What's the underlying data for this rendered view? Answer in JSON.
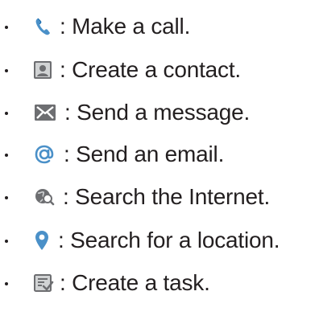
{
  "items": [
    {
      "icon": "phone-icon",
      "text": ": Make a call."
    },
    {
      "icon": "contact-icon",
      "text": ": Create a contact."
    },
    {
      "icon": "message-icon",
      "text": ": Send a message."
    },
    {
      "icon": "email-at-icon",
      "text": ": Send an email."
    },
    {
      "icon": "internet-search-icon",
      "text": ": Search the Internet."
    },
    {
      "icon": "location-pin-icon",
      "text": ": Search for a location."
    },
    {
      "icon": "task-icon",
      "text": ": Create a task."
    }
  ],
  "colors": {
    "text": "#231f20",
    "icon_blue": "#4a90c8",
    "icon_blue_dark": "#1f6fb0",
    "icon_gray": "#6d6e71",
    "icon_light_gray": "#d1d3d4"
  }
}
